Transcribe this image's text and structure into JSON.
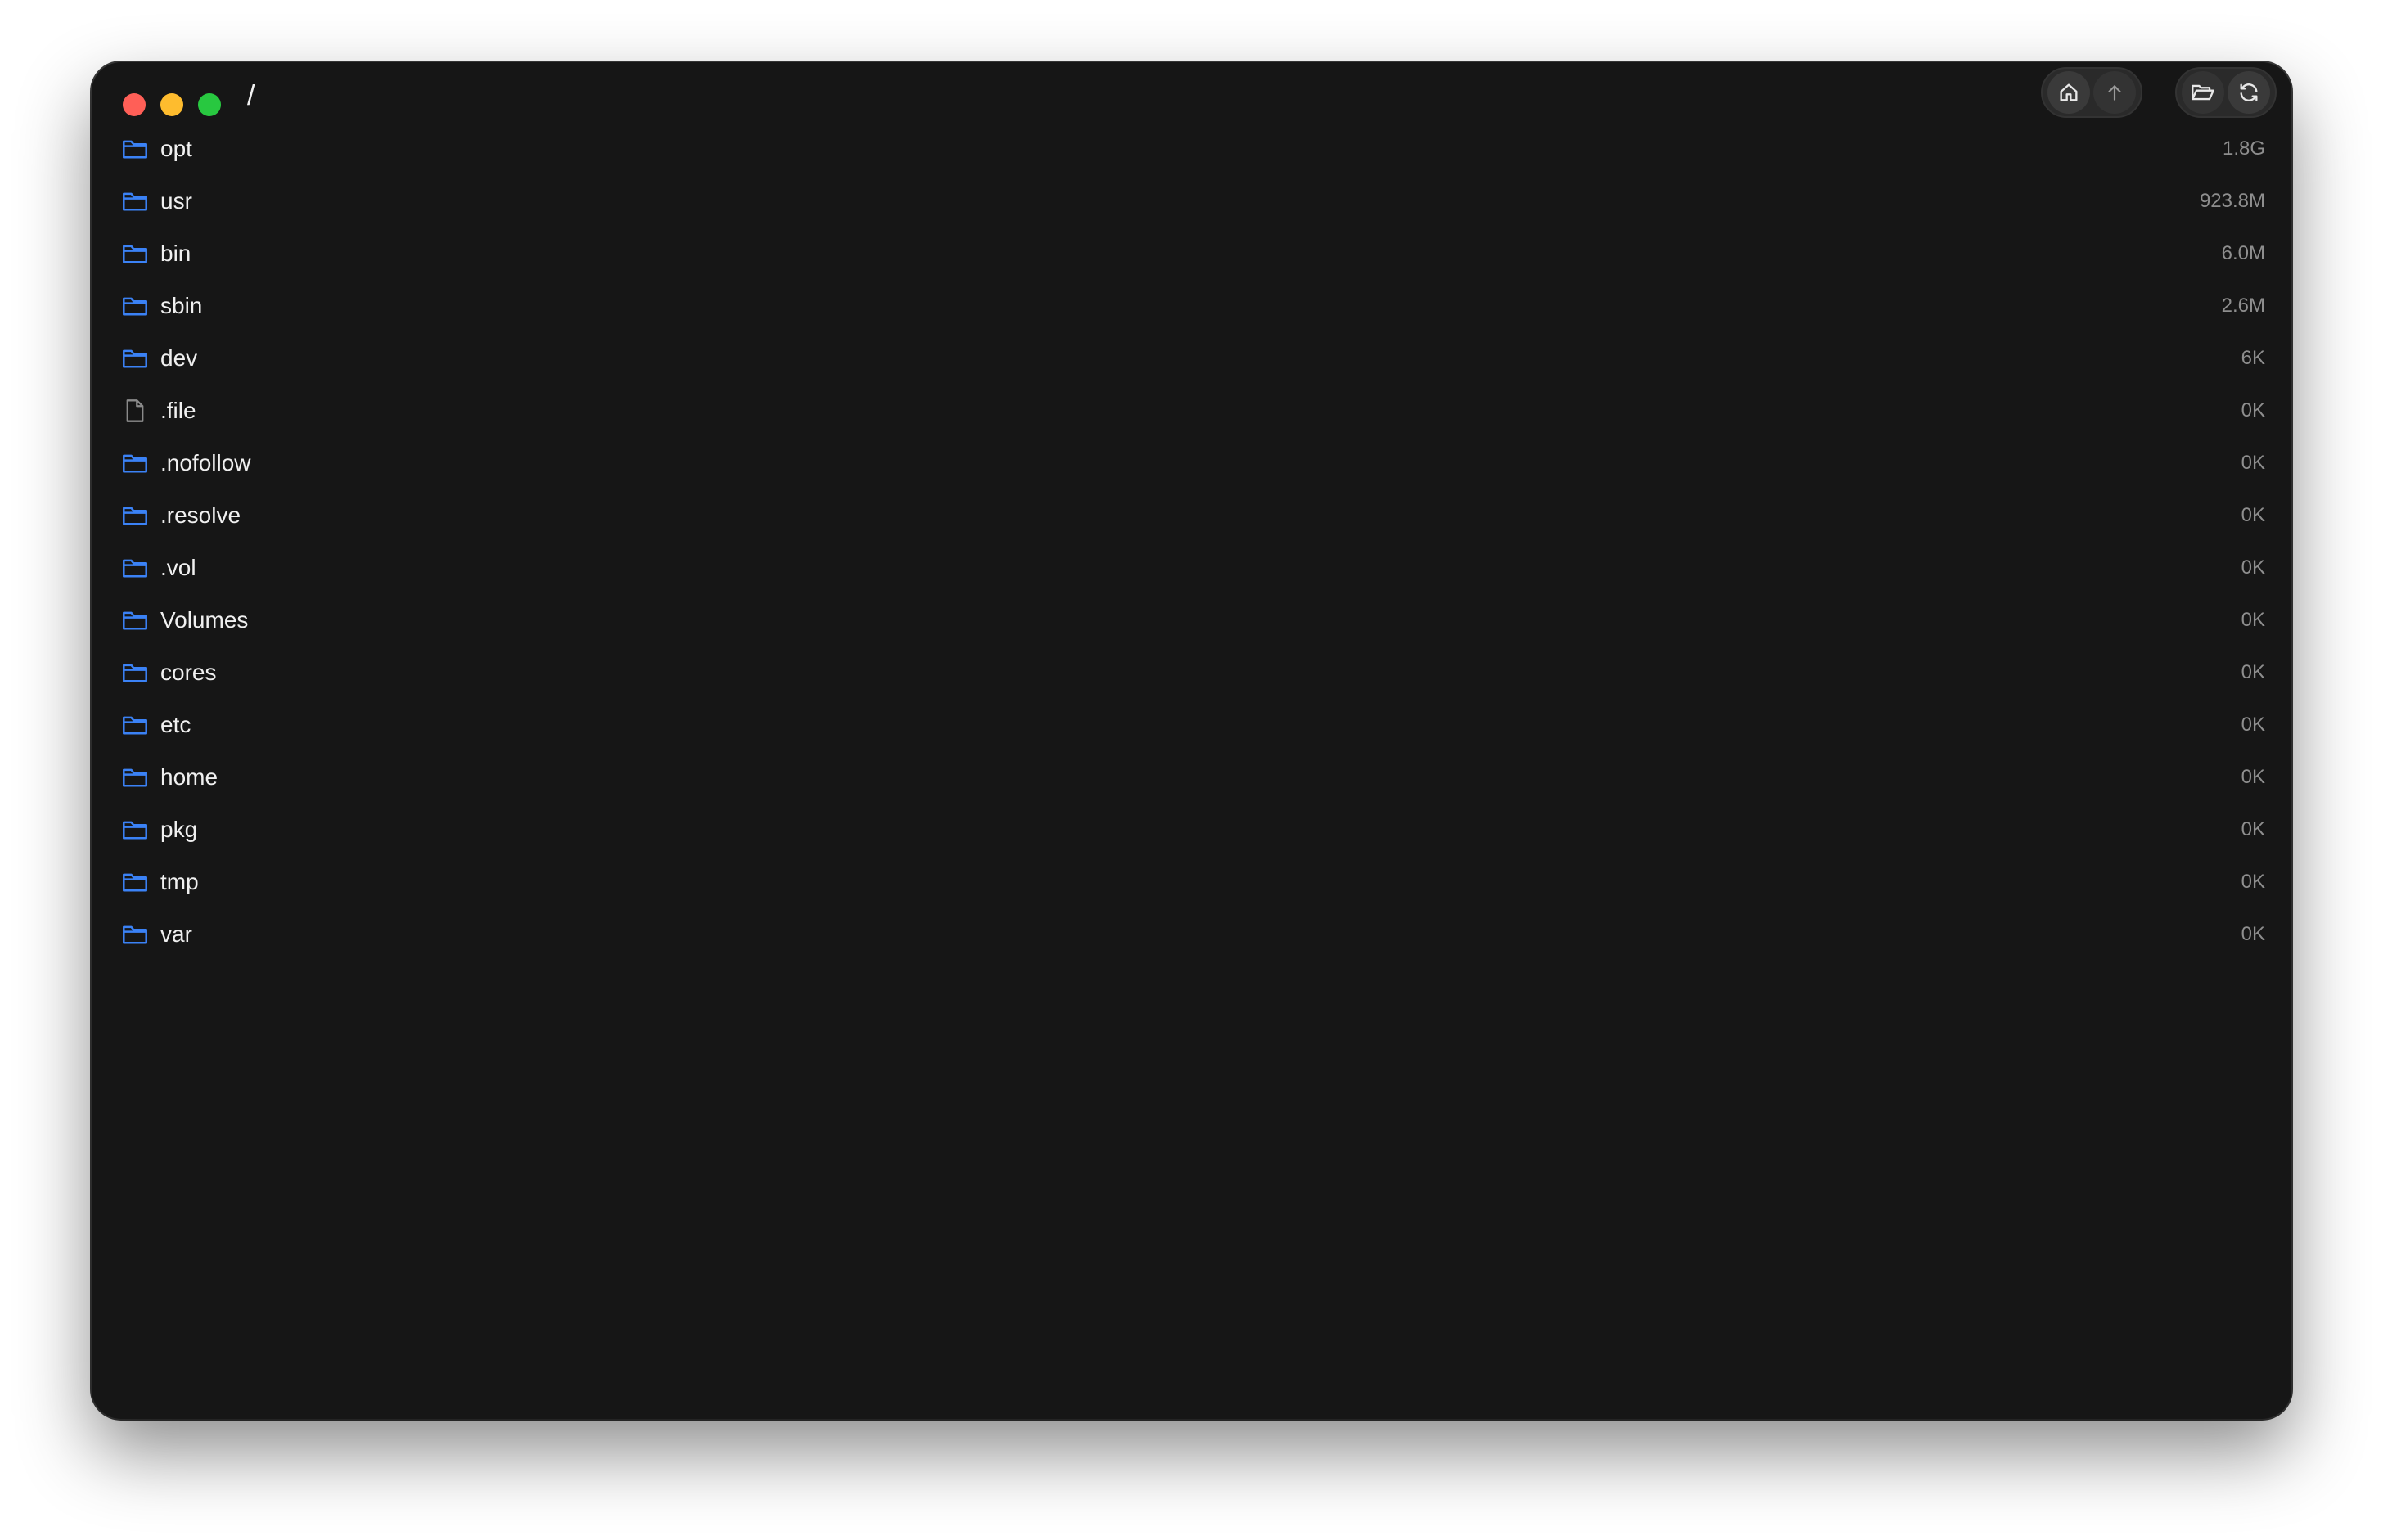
{
  "window": {
    "path": "/",
    "traffic_colors": {
      "close": "#ff5f57",
      "minimize": "#febc2e",
      "zoom": "#28c840"
    }
  },
  "toolbar": {
    "home_icon": "home-icon",
    "up_icon": "arrow-up-icon",
    "open_folder_icon": "folder-open-icon",
    "refresh_icon": "refresh-icon"
  },
  "colors": {
    "folder": "#3b82f6",
    "file": "#8a8a8a"
  },
  "entries": [
    {
      "name": "opt",
      "size": "1.8G",
      "kind": "folder"
    },
    {
      "name": "usr",
      "size": "923.8M",
      "kind": "folder"
    },
    {
      "name": "bin",
      "size": "6.0M",
      "kind": "folder"
    },
    {
      "name": "sbin",
      "size": "2.6M",
      "kind": "folder"
    },
    {
      "name": "dev",
      "size": "6K",
      "kind": "folder"
    },
    {
      "name": ".file",
      "size": "0K",
      "kind": "file"
    },
    {
      "name": ".nofollow",
      "size": "0K",
      "kind": "folder"
    },
    {
      "name": ".resolve",
      "size": "0K",
      "kind": "folder"
    },
    {
      "name": ".vol",
      "size": "0K",
      "kind": "folder"
    },
    {
      "name": "Volumes",
      "size": "0K",
      "kind": "folder"
    },
    {
      "name": "cores",
      "size": "0K",
      "kind": "folder"
    },
    {
      "name": "etc",
      "size": "0K",
      "kind": "folder"
    },
    {
      "name": "home",
      "size": "0K",
      "kind": "folder"
    },
    {
      "name": "pkg",
      "size": "0K",
      "kind": "folder"
    },
    {
      "name": "tmp",
      "size": "0K",
      "kind": "folder"
    },
    {
      "name": "var",
      "size": "0K",
      "kind": "folder"
    }
  ]
}
